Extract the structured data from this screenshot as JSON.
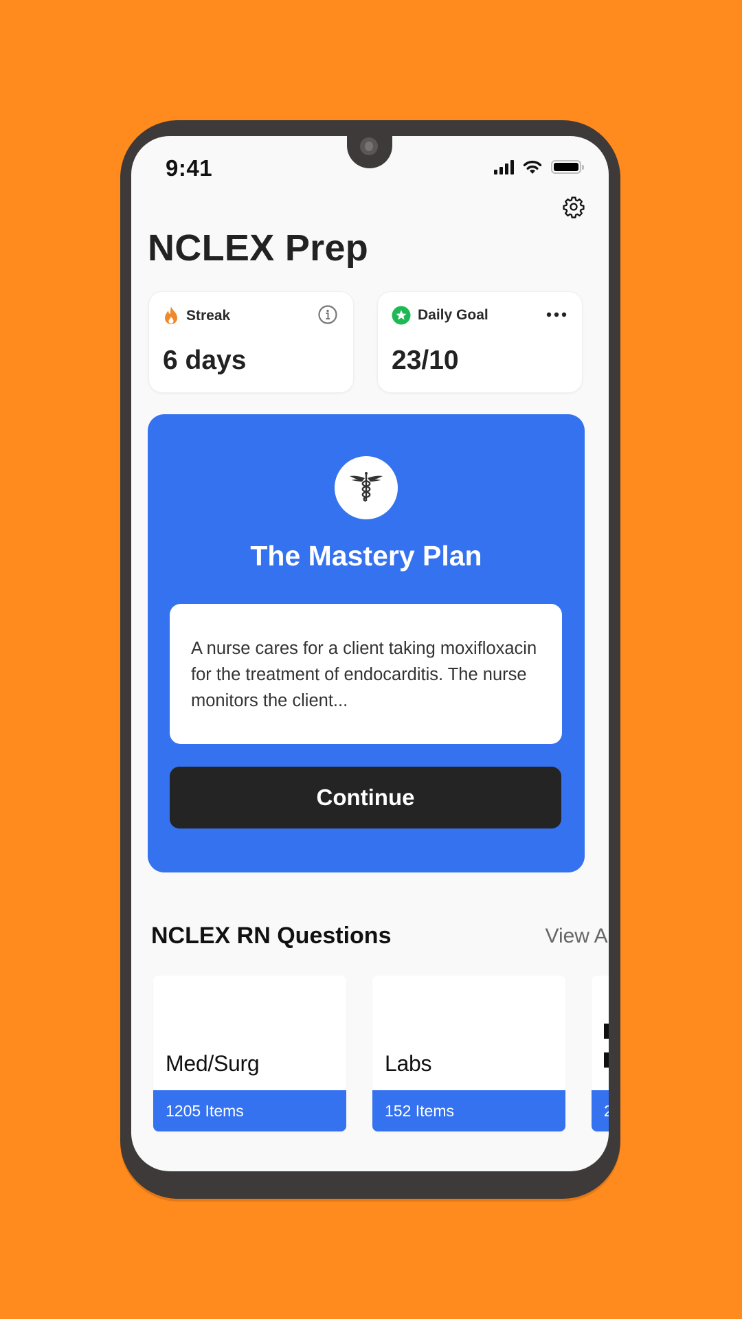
{
  "colors": {
    "background": "#FF8A1E",
    "accent_blue": "#3572EF",
    "streak_orange": "#F0892B",
    "goal_green": "#1DB954",
    "button_dark": "#242424"
  },
  "status_bar": {
    "time": "9:41",
    "icons": [
      "signal-icon",
      "wifi-icon",
      "battery-icon"
    ]
  },
  "header": {
    "settings_icon": "gear-icon",
    "title": "NCLEX Prep"
  },
  "stats": {
    "streak": {
      "icon": "flame-icon",
      "label": "Streak",
      "value": "6 days",
      "action_icon": "info-icon"
    },
    "daily_goal": {
      "icon": "star-badge-icon",
      "label": "Daily Goal",
      "value": "23/10",
      "action_icon": "more-horizontal-icon"
    }
  },
  "mastery_plan": {
    "icon": "caduceus-icon",
    "title": "The Mastery Plan",
    "question_preview": "A nurse cares for a client taking moxifloxacin for the treatment of endocarditis. The nurse monitors the client...",
    "button_label": "Continue"
  },
  "questions_section": {
    "title": "NCLEX RN Questions",
    "view_all_label": "View All",
    "categories": [
      {
        "name": "Med/Surg",
        "count": "1205 Items"
      },
      {
        "name": "Labs",
        "count": "152 Items"
      },
      {
        "name": "",
        "count": "2"
      }
    ]
  }
}
